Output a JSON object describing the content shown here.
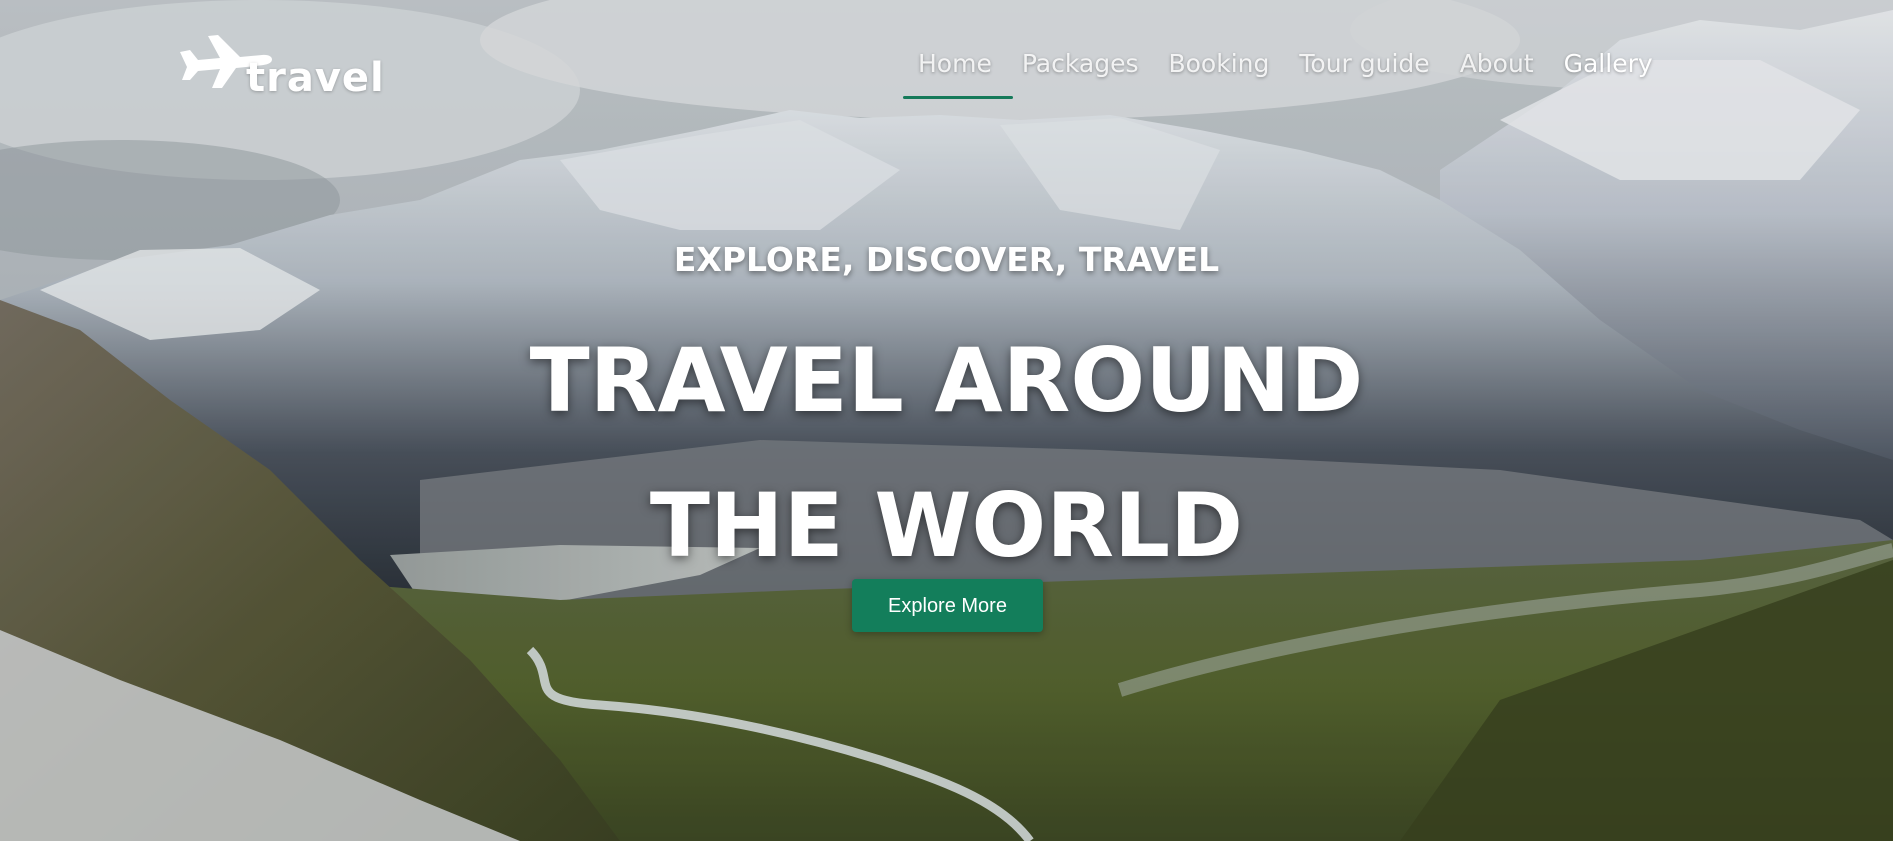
{
  "logo": {
    "text": "travel",
    "icon": "airplane-icon"
  },
  "nav": {
    "items": [
      {
        "label": "Home"
      },
      {
        "label": "Packages"
      },
      {
        "label": "Booking"
      },
      {
        "label": "Tour guide"
      },
      {
        "label": "About"
      },
      {
        "label": "Gallery"
      }
    ],
    "active_index": 0
  },
  "hero": {
    "tagline": "EXPLORE, DISCOVER, TRAVEL",
    "headline_line1": "TRAVEL AROUND",
    "headline_line2": "THE WORLD",
    "cta_label": "Explore More"
  },
  "colors": {
    "accent": "#137e5b",
    "text": "#ffffff"
  }
}
